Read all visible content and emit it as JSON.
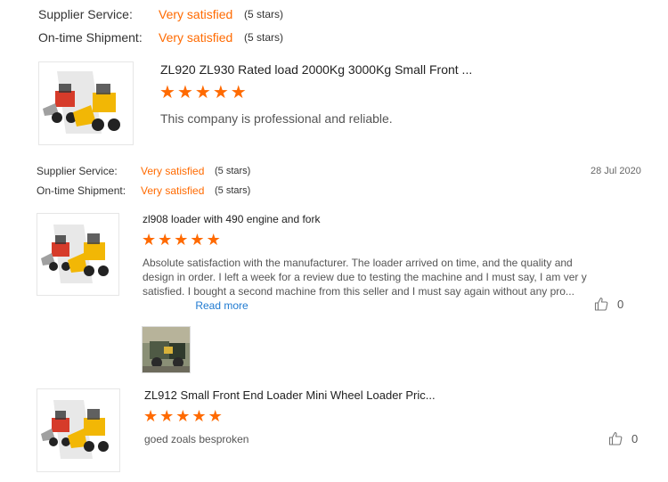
{
  "top_ratings": {
    "supplier_label": "Supplier Service:",
    "supplier_value": "Very satisfied",
    "supplier_stars": "(5 stars)",
    "shipment_label": "On-time Shipment:",
    "shipment_value": "Very satisfied",
    "shipment_stars": "(5 stars)"
  },
  "review1": {
    "product_title": "ZL920 ZL930 Rated load 2000Kg 3000Kg Small Front ...",
    "rating": 5,
    "text": "This company is professional and reliable."
  },
  "review2": {
    "supplier_label": "Supplier Service:",
    "supplier_value": "Very satisfied",
    "supplier_stars": "(5 stars)",
    "shipment_label": "On-time Shipment:",
    "shipment_value": "Very satisfied",
    "shipment_stars": "(5 stars)",
    "date": "28 Jul 2020",
    "product_title": "zl908 loader with 490 engine and fork",
    "rating": 5,
    "text": "Absolute satisfaction with the manufacturer. The loader arrived on time, and the quality and design in order. I left a week for a review due to testing the machine and I must say, I am ver y satisfied. I bought a second machine from this seller and I must say again without any pro...",
    "read_more": "Read more",
    "likes": "0"
  },
  "review3": {
    "product_title": "ZL912 Small Front End Loader Mini Wheel Loader Pric...",
    "rating": 5,
    "text": "goed zoals besproken",
    "likes": "0"
  },
  "icons": {
    "star": "star-icon",
    "like": "thumbs-up-icon"
  },
  "colors": {
    "accent": "#ff6a00",
    "link": "#1f7ad1"
  }
}
